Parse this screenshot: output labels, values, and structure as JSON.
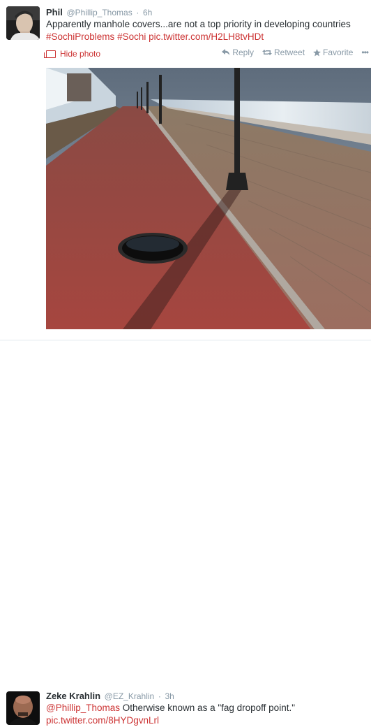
{
  "tweet1": {
    "name": "Phil",
    "handle": "@Phillip_Thomas",
    "sep": "·",
    "time": "6h",
    "text": "Apparently manhole covers...are not a top priority in developing countries",
    "tags": [
      "#SochiProblems",
      "#Sochi"
    ],
    "link": "pic.twitter.com/H2LH8tvHDt",
    "hide_photo": "Hide photo",
    "actions": {
      "reply": "Reply",
      "retweet": "Retweet",
      "favorite": "Favorite",
      "more": "•••"
    }
  },
  "tweet2": {
    "name": "Zeke Krahlin",
    "handle": "@EZ_Krahlin",
    "sep": "·",
    "time": "3h",
    "mention": "@Phillip_Thomas",
    "text": "Otherwise known as a \"fag dropoff point.\"",
    "link": "pic.twitter.com/8HYDgvnLrl"
  },
  "colors": {
    "link": "#cc3333",
    "muted": "#8899a6",
    "text": "#292f33"
  }
}
